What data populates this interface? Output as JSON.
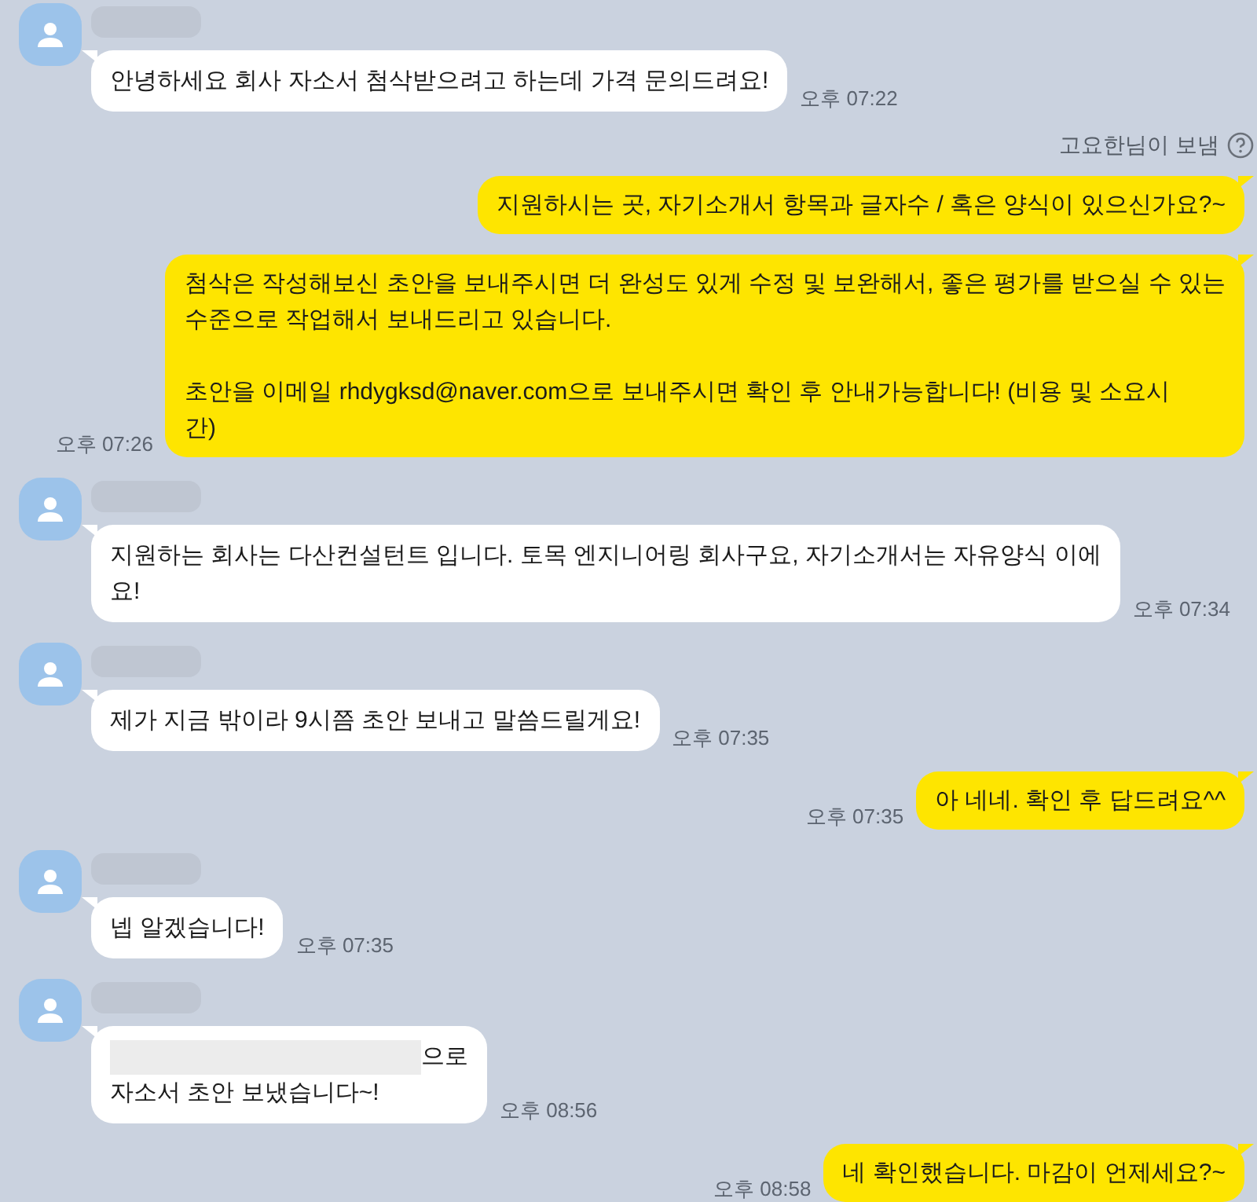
{
  "messages": [
    {
      "kind": "incoming",
      "text": "안녕하세요 회사 자소서 첨삭받으려고 하는데 가격 문의드려요!",
      "time": "오후 07:22"
    },
    {
      "kind": "sender_note",
      "text": "고요한님이 보냄"
    },
    {
      "kind": "outgoing",
      "text": "지원하시는 곳, 자기소개서 항목과 글자수 / 혹은 양식이 있으신가요?~"
    },
    {
      "kind": "outgoing",
      "text": "첨삭은 작성해보신 초안을 보내주시면 더 완성도 있게 수정 및 보완해서, 좋은 평가를 받으실 수 있는\n수준으로 작업해서 보내드리고 있습니다.\n\n초안을 이메일 rhdygksd@naver.com으로 보내주시면 확인 후 안내가능합니다! (비용 및 소요시\n간)",
      "time": "오후 07:26"
    },
    {
      "kind": "incoming",
      "text": "지원하는 회사는 다산컨설턴트 입니다. 토목 엔지니어링 회사구요, 자기소개서는 자유양식 이에\n요!",
      "time": "오후 07:34"
    },
    {
      "kind": "incoming",
      "text": "제가 지금 밖이라 9시쯤 초안 보내고 말씀드릴게요!",
      "time": "오후 07:35"
    },
    {
      "kind": "outgoing",
      "text": "아 네네. 확인 후 답드려요^^",
      "time": "오후 07:35"
    },
    {
      "kind": "incoming",
      "text": "넵 알겠습니다!",
      "time": "오후 07:35"
    },
    {
      "kind": "incoming",
      "redacted": true,
      "text": "으로\n자소서 초안 보냈습니다~!",
      "time": "오후 08:56"
    },
    {
      "kind": "outgoing",
      "text": "네 확인했습니다. 마감이 언제세요?~",
      "time": "오후 08:58"
    }
  ]
}
